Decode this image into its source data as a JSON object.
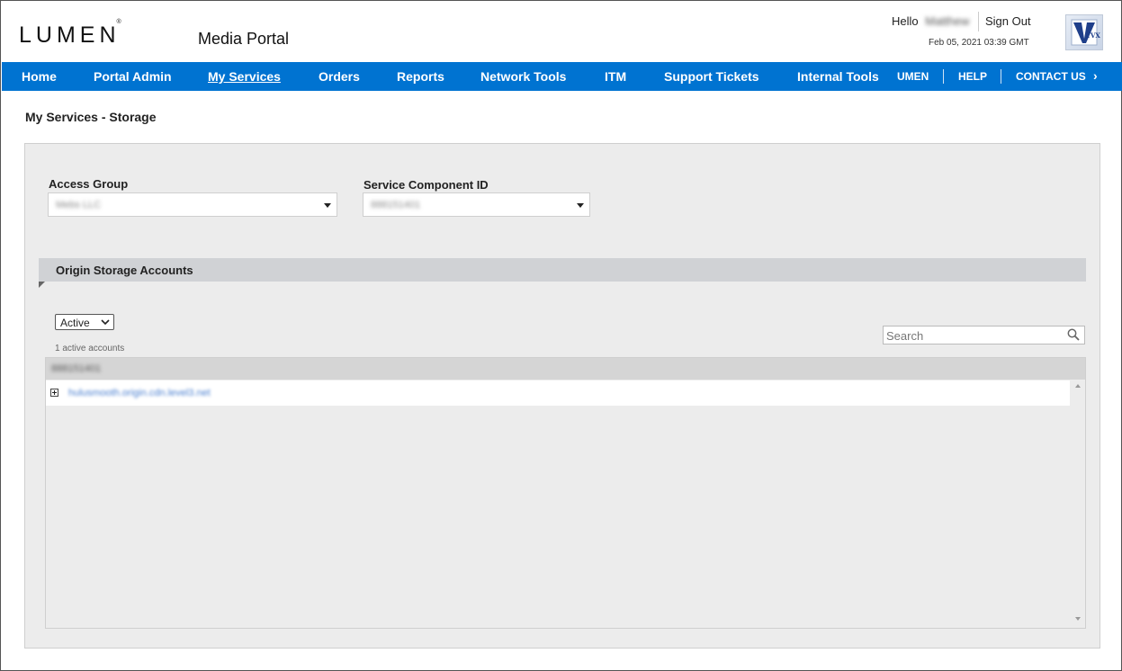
{
  "header": {
    "logo_text": "LUMEN",
    "logo_mark": "®",
    "portal_title": "Media Portal",
    "hello_label": "Hello",
    "user_name": "Matthew",
    "sign_out": "Sign Out",
    "datetime": "Feb 05, 2021 03:39 GMT",
    "partner_logo": "vyvx-logo"
  },
  "nav": {
    "items": [
      "Home",
      "Portal Admin",
      "My Services",
      "Orders",
      "Reports",
      "Network Tools",
      "ITM",
      "Support Tickets",
      "Internal Tools"
    ],
    "active": "My Services",
    "utility": [
      "UMEN",
      "HELP",
      "CONTACT US"
    ],
    "chevron_icon": "chevron-right-icon",
    "bar_color": "#0073d1"
  },
  "page": {
    "title": "My Services - Storage",
    "access_group": {
      "label": "Access Group",
      "value": "Mebs LLC"
    },
    "service_component": {
      "label": "Service Component ID",
      "value": "888151401"
    },
    "section": {
      "title": "Origin Storage Accounts",
      "status_value": "Active",
      "count_text": "1 active accounts",
      "search_placeholder": "Search",
      "search_icon": "search-icon",
      "group_header": "888151401",
      "rows": [
        {
          "label": "hulusmooth.origin.cdn.level3.net"
        }
      ]
    }
  }
}
